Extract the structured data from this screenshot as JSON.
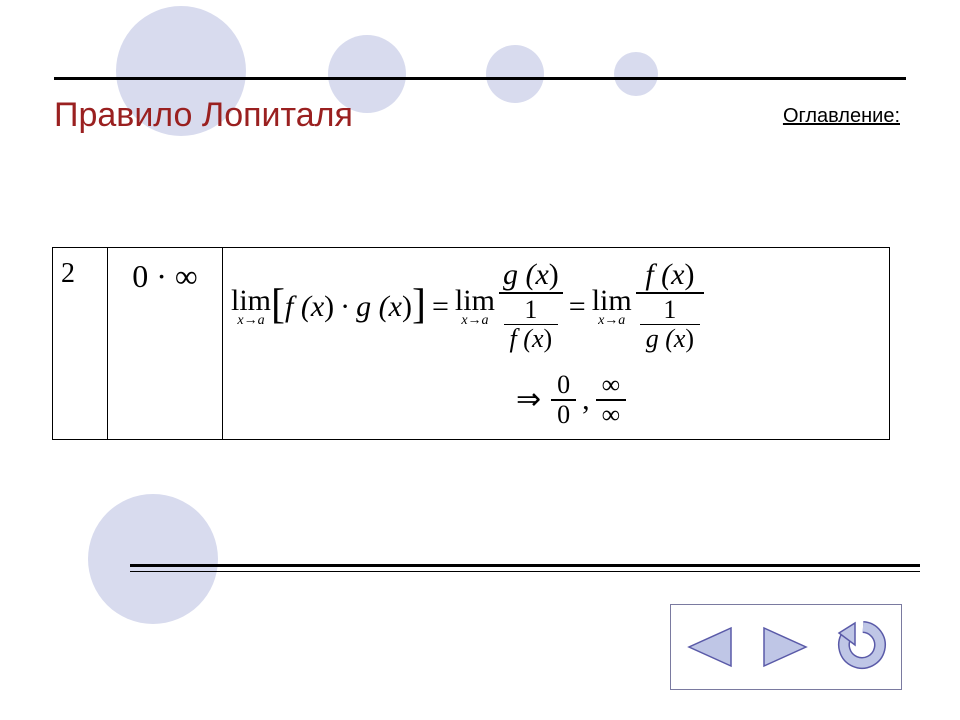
{
  "header": {
    "title": "Правило Лопиталя",
    "toc_label": "Оглавление:"
  },
  "table": {
    "row_number": "2",
    "indeterminate_form": "0 · ∞"
  },
  "math": {
    "lim_label": "lim",
    "lim_sub": "x→a",
    "f_of_x_open": "f (",
    "g_of_x_open": "g (",
    "var_x": "x",
    "close_paren": ")",
    "dot": "·",
    "equals": "=",
    "one": "1",
    "implies": "⇒",
    "zero": "0",
    "infty": "∞",
    "comma": ","
  },
  "nav": {
    "prev": "previous-slide",
    "next": "next-slide",
    "return": "return-to-contents"
  },
  "colors": {
    "accent_circle": "#d8dbee",
    "title": "#9a2020",
    "nav_fill": "#bfc6e6",
    "nav_stroke": "#5a5aa8"
  }
}
